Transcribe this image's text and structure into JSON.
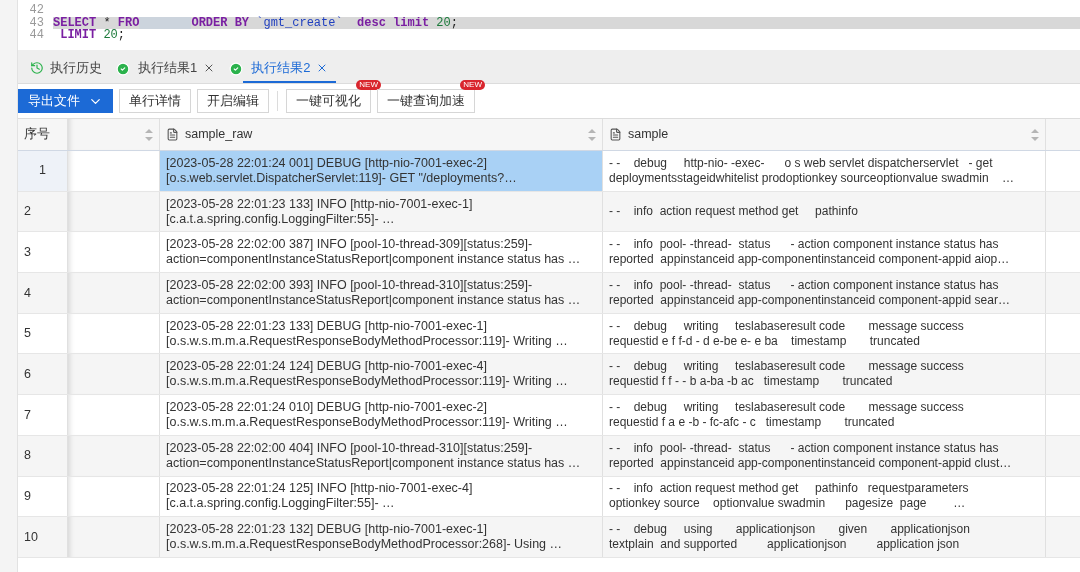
{
  "editor": {
    "lines": [
      {
        "number": "42",
        "highlighted": false
      },
      {
        "number": "43",
        "highlighted": true,
        "tokens": [
          {
            "kind": "keyword",
            "text": "SELECT"
          },
          {
            "kind": "plain",
            "text": " * "
          },
          {
            "kind": "keyword",
            "text": "FRO"
          },
          {
            "kind": "redacted"
          },
          {
            "kind": "keyword",
            "text": "ORDER BY "
          },
          {
            "kind": "identifier",
            "text": "`gmt_create`"
          },
          {
            "kind": "keyword",
            "text": "  desc limit "
          },
          {
            "kind": "number",
            "text": "20"
          },
          {
            "kind": "plain",
            "text": ";"
          }
        ]
      },
      {
        "number": "44",
        "highlighted": false,
        "tokens": [
          {
            "kind": "keyword",
            "text": " LIMIT "
          },
          {
            "kind": "number",
            "text": "20"
          },
          {
            "kind": "plain",
            "text": ";"
          }
        ]
      }
    ]
  },
  "tabs": [
    {
      "label": "执行历史",
      "kind": "history",
      "selected": false,
      "closable": false,
      "ok": false
    },
    {
      "label": "执行结果1",
      "kind": "result",
      "selected": false,
      "closable": true,
      "ok": true
    },
    {
      "label": "执行结果2",
      "kind": "result",
      "selected": true,
      "closable": true,
      "ok": true
    }
  ],
  "toolbar": [
    {
      "label": "导出文件",
      "kind": "primary"
    },
    {
      "label": "单行详情",
      "kind": "default"
    },
    {
      "label": "开启编辑",
      "kind": "default"
    },
    {
      "label": "一键可视化",
      "kind": "default",
      "badge": "NEW"
    },
    {
      "label": "一键查询加速",
      "kind": "default",
      "badge": "NEW"
    }
  ],
  "table": {
    "columns": [
      {
        "label": "序号",
        "kind": "index"
      },
      {
        "kind": "blank"
      },
      {
        "label": "sample_raw",
        "kind": "field"
      },
      {
        "label": "sample",
        "kind": "field"
      }
    ],
    "rows": [
      {
        "index": "1",
        "selected": true,
        "raw": "[2023-05-28 22:01:24 001] DEBUG [http-nio-7001-exec-2]\n[o.s.web.servlet.DispatcherServlet:119]- GET \"/deployments?…",
        "sample": "- -    debug     http-nio- -exec-      o s web servlet dispatcherservlet   - get\ndeploymentsstageidwhitelist prodoptionkey sourceoptionvalue swadmin    …"
      },
      {
        "index": "2",
        "selected": false,
        "raw": "[2023-05-28 22:01:23 133] INFO  [http-nio-7001-exec-1]\n[c.a.t.a.spring.config.LoggingFilter:55]- …",
        "sample": "- -    info  action request method get     pathinfo"
      },
      {
        "index": "3",
        "selected": false,
        "raw": "[2023-05-28 22:02:00 387] INFO  [pool-10-thread-309][status:259]-\naction=componentInstanceStatusReport|component instance status has …",
        "sample": "- -    info  pool- -thread-  status      - action component instance status has\nreported  appinstanceid app-componentinstanceid component-appid aiop…"
      },
      {
        "index": "4",
        "selected": false,
        "raw": "[2023-05-28 22:02:00 393] INFO  [pool-10-thread-310][status:259]-\naction=componentInstanceStatusReport|component instance status has …",
        "sample": "- -    info  pool- -thread-  status      - action component instance status has\nreported  appinstanceid app-componentinstanceid component-appid sear…"
      },
      {
        "index": "5",
        "selected": false,
        "raw": "[2023-05-28 22:01:23 133] DEBUG [http-nio-7001-exec-1]\n[o.s.w.s.m.m.a.RequestResponseBodyMethodProcessor:119]- Writing …",
        "sample": "- -    debug     writing     teslabaseresult code       message success\nrequestid e f f-d - d e-be e- e ba    timestamp       truncated"
      },
      {
        "index": "6",
        "selected": false,
        "raw": "[2023-05-28 22:01:24 124] DEBUG [http-nio-7001-exec-4]\n[o.s.w.s.m.m.a.RequestResponseBodyMethodProcessor:119]- Writing …",
        "sample": "- -    debug     writing     teslabaseresult code       message success\nrequestid f f - - b a-ba -b ac   timestamp       truncated"
      },
      {
        "index": "7",
        "selected": false,
        "raw": "[2023-05-28 22:01:24 010] DEBUG [http-nio-7001-exec-2]\n[o.s.w.s.m.m.a.RequestResponseBodyMethodProcessor:119]- Writing …",
        "sample": "- -    debug     writing     teslabaseresult code       message success\nrequestid f a e -b - fc-afc - c   timestamp       truncated"
      },
      {
        "index": "8",
        "selected": false,
        "raw": "[2023-05-28 22:02:00 404] INFO  [pool-10-thread-310][status:259]-\naction=componentInstanceStatusReport|component instance status has …",
        "sample": "- -    info  pool- -thread-  status      - action component instance status has\nreported  appinstanceid app-componentinstanceid component-appid clust…"
      },
      {
        "index": "9",
        "selected": false,
        "raw": "[2023-05-28 22:01:24 125] INFO  [http-nio-7001-exec-4]\n[c.a.t.a.spring.config.LoggingFilter:55]- …",
        "sample": "- -    info  action request method get     pathinfo   requestparameters\noptionkey source    optionvalue swadmin      pagesize  page        …"
      },
      {
        "index": "10",
        "selected": false,
        "raw": "[2023-05-28 22:01:23 132] DEBUG [http-nio-7001-exec-1]\n[o.s.w.s.m.m.a.RequestResponseBodyMethodProcessor:268]- Using …",
        "sample": "- -    debug     using       applicationjson       given       applicationjson\ntextplain  and supported         applicationjson         application json"
      }
    ]
  }
}
